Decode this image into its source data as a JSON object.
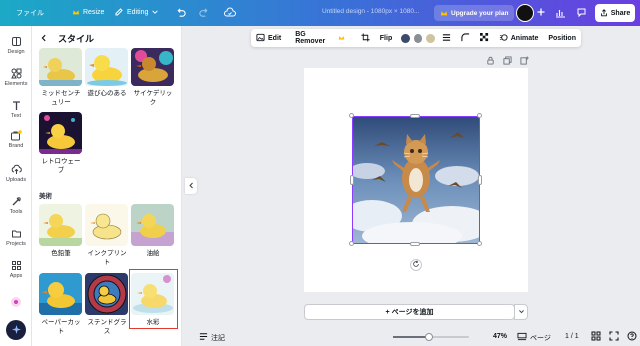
{
  "topbar": {
    "file_label": "ファイル",
    "resize_label": "Resize",
    "editing_label": "Editing",
    "doc_title": "Untitled design - 1080px × 1080...",
    "upgrade_label": "Upgrade your plan",
    "share_label": "Share"
  },
  "rail": {
    "items": [
      {
        "label": "Design",
        "icon": "design-icon"
      },
      {
        "label": "Elements",
        "icon": "elements-icon"
      },
      {
        "label": "Text",
        "icon": "text-icon"
      },
      {
        "label": "Brand",
        "icon": "brand-icon"
      },
      {
        "label": "Uploads",
        "icon": "uploads-icon"
      },
      {
        "label": "Tools",
        "icon": "tools-icon"
      },
      {
        "label": "Projects",
        "icon": "projects-icon"
      },
      {
        "label": "Apps",
        "icon": "apps-icon"
      }
    ]
  },
  "panel": {
    "title": "スタイル",
    "section_art": "美術",
    "styles_top": [
      {
        "label": "ミッドセンチ\nュリー"
      },
      {
        "label": "遊び心のある"
      },
      {
        "label": "サイケデリッ\nク"
      },
      {
        "label": "レトロウェー\nブ"
      }
    ],
    "styles_art": [
      {
        "label": "色鉛筆"
      },
      {
        "label": "インクプリン\nト"
      },
      {
        "label": "油絵"
      },
      {
        "label": "ペーパーカッ\nト"
      },
      {
        "label": "ステンドグラ\nス"
      },
      {
        "label": "水彩",
        "selected": true
      }
    ]
  },
  "context_toolbar": {
    "edit_label": "Edit",
    "bg_remover_label": "BG Remover",
    "flip_label": "Flip",
    "colors": [
      "#3c4a6b",
      "#8a8f95",
      "#cfc4a0"
    ],
    "animate_label": "Animate",
    "position_label": "Position"
  },
  "canvas": {
    "add_page_label": "+ ページを追加"
  },
  "bottombar": {
    "notes_label": "注記",
    "zoom": "47%",
    "zoom_fraction": 0.47,
    "pages_label": "ページ",
    "page_count": "1 / 1"
  },
  "colors": {
    "accent": "#8b3dff",
    "selection": "#e23b2e"
  }
}
